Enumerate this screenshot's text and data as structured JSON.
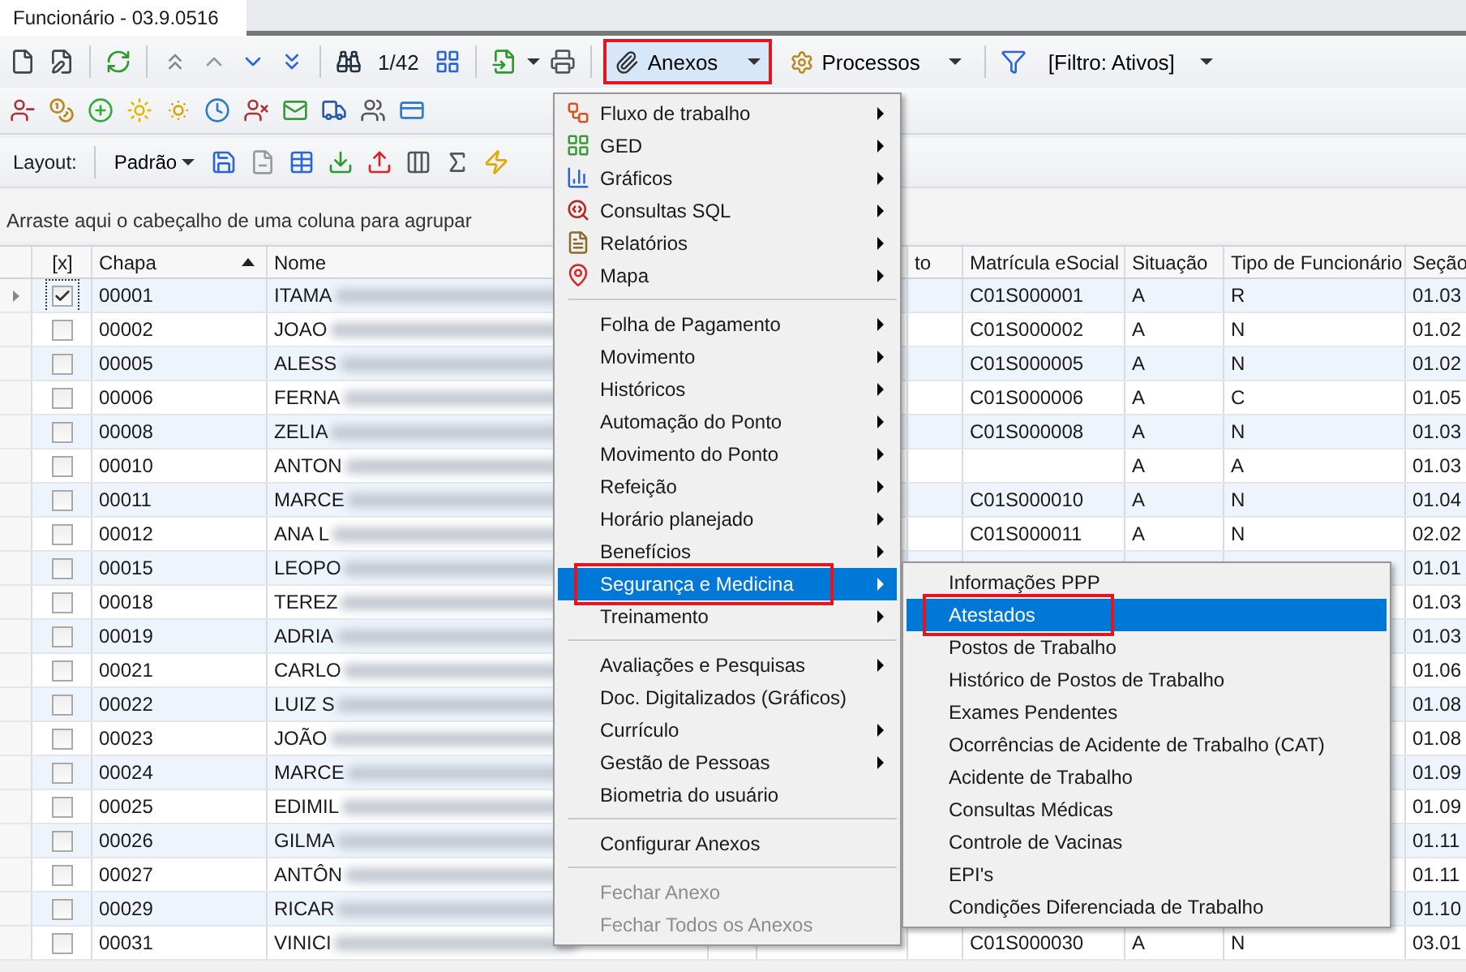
{
  "tab": {
    "title": "Funcionário - 03.9.0516"
  },
  "toolbar": {
    "counter": "1/42",
    "buttons": [
      {
        "label": "Anexos",
        "selected": true,
        "annotated": true
      },
      {
        "label": "Processos",
        "selected": false,
        "annotated": false
      }
    ],
    "filter": "[Filtro: Ativos]"
  },
  "layout_bar": {
    "label": "Layout:",
    "preset": "Padrão"
  },
  "group_panel": {
    "hint": "Arraste aqui o cabeçalho de uma coluna para agrupar"
  },
  "grid": {
    "columns": [
      {
        "label": "[x]",
        "sorted": false
      },
      {
        "label": "Chapa",
        "sorted": true
      },
      {
        "label": "Nome",
        "sorted": false
      },
      {
        "label": "to",
        "sorted": false
      },
      {
        "label": "Matrícula eSocial",
        "sorted": false
      },
      {
        "label": "Situação",
        "sorted": false
      },
      {
        "label": "Tipo de Funcionário",
        "sorted": false
      },
      {
        "label": "Seção",
        "sorted": false
      }
    ],
    "rows": [
      {
        "chapa": "00001",
        "nome": "ITAMA",
        "checked": true,
        "current": true,
        "matricula": "C01S000001",
        "situacao": "A",
        "tipo": "R",
        "secao": "01.03"
      },
      {
        "chapa": "00002",
        "nome": "JOAO",
        "checked": false,
        "current": false,
        "matricula": "C01S000002",
        "situacao": "A",
        "tipo": "N",
        "secao": "01.02"
      },
      {
        "chapa": "00005",
        "nome": "ALESS",
        "checked": false,
        "current": false,
        "matricula": "C01S000005",
        "situacao": "A",
        "tipo": "N",
        "secao": "01.02"
      },
      {
        "chapa": "00006",
        "nome": "FERNA",
        "checked": false,
        "current": false,
        "matricula": "C01S000006",
        "situacao": "A",
        "tipo": "C",
        "secao": "01.05"
      },
      {
        "chapa": "00008",
        "nome": "ZELIA",
        "checked": false,
        "current": false,
        "matricula": "C01S000008",
        "situacao": "A",
        "tipo": "N",
        "secao": "01.03"
      },
      {
        "chapa": "00010",
        "nome": "ANTON",
        "checked": false,
        "current": false,
        "situacao": "A",
        "tipo": "A",
        "secao": "01.03"
      },
      {
        "chapa": "00011",
        "nome": "MARCE",
        "checked": false,
        "current": false,
        "matricula": "C01S000010",
        "situacao": "A",
        "tipo": "N",
        "secao": "01.04"
      },
      {
        "chapa": "00012",
        "nome": "ANA L",
        "checked": false,
        "current": false,
        "matricula": "C01S000011",
        "situacao": "A",
        "tipo": "N",
        "secao": "02.02"
      },
      {
        "chapa": "00015",
        "nome": "LEOPO",
        "checked": false,
        "current": false,
        "secao": "01.01"
      },
      {
        "chapa": "00018",
        "nome": "TEREZ",
        "checked": false,
        "current": false,
        "secao": "01.03"
      },
      {
        "chapa": "00019",
        "nome": "ADRIA",
        "checked": false,
        "current": false,
        "secao": "01.03"
      },
      {
        "chapa": "00021",
        "nome": "CARLO",
        "checked": false,
        "current": false,
        "secao": "01.06"
      },
      {
        "chapa": "00022",
        "nome": "LUIZ S",
        "checked": false,
        "current": false,
        "secao": "01.08"
      },
      {
        "chapa": "00023",
        "nome": "JOÃO",
        "checked": false,
        "current": false,
        "secao": "01.08"
      },
      {
        "chapa": "00024",
        "nome": "MARCE",
        "checked": false,
        "current": false,
        "secao": "01.09"
      },
      {
        "chapa": "00025",
        "nome": "EDIMIL",
        "checked": false,
        "current": false,
        "secao": "01.09"
      },
      {
        "chapa": "00026",
        "nome": "GILMA",
        "checked": false,
        "current": false,
        "secao": "01.11"
      },
      {
        "chapa": "00027",
        "nome": "ANTÔN",
        "checked": false,
        "current": false,
        "secao": "01.11"
      },
      {
        "chapa": "00029",
        "nome": "RICAR",
        "checked": false,
        "current": false,
        "secao": "01.10"
      },
      {
        "chapa": "00031",
        "nome": "VINICI",
        "checked": false,
        "current": false,
        "matricula": "C01S000030",
        "situacao": "A",
        "tipo": "N",
        "secao": "03.01"
      }
    ]
  },
  "menu": {
    "groups": [
      [
        {
          "label": "Fluxo de trabalho",
          "submenu": true,
          "disabled": false,
          "selected": false,
          "annotated": false
        },
        {
          "label": "GED",
          "submenu": true,
          "disabled": false,
          "selected": false,
          "annotated": false
        },
        {
          "label": "Gráficos",
          "submenu": true,
          "disabled": false,
          "selected": false,
          "annotated": false
        },
        {
          "label": "Consultas SQL",
          "submenu": true,
          "disabled": false,
          "selected": false,
          "annotated": false
        },
        {
          "label": "Relatórios",
          "submenu": true,
          "disabled": false,
          "selected": false,
          "annotated": false
        },
        {
          "label": "Mapa",
          "submenu": true,
          "disabled": false,
          "selected": false,
          "annotated": false
        }
      ],
      [
        {
          "label": "Folha de Pagamento",
          "submenu": true,
          "disabled": false,
          "selected": false,
          "annotated": false
        },
        {
          "label": "Movimento",
          "submenu": true,
          "disabled": false,
          "selected": false,
          "annotated": false
        },
        {
          "label": "Históricos",
          "submenu": true,
          "disabled": false,
          "selected": false,
          "annotated": false
        },
        {
          "label": "Automação do Ponto",
          "submenu": true,
          "disabled": false,
          "selected": false,
          "annotated": false
        },
        {
          "label": "Movimento do Ponto",
          "submenu": true,
          "disabled": false,
          "selected": false,
          "annotated": false
        },
        {
          "label": "Refeição",
          "submenu": true,
          "disabled": false,
          "selected": false,
          "annotated": false
        },
        {
          "label": "Horário planejado",
          "submenu": true,
          "disabled": false,
          "selected": false,
          "annotated": false
        },
        {
          "label": "Benefícios",
          "submenu": true,
          "disabled": false,
          "selected": false,
          "annotated": false
        },
        {
          "label": "Segurança e Medicina",
          "submenu": true,
          "disabled": false,
          "selected": true,
          "annotated": true
        },
        {
          "label": "Treinamento",
          "submenu": true,
          "disabled": false,
          "selected": false,
          "annotated": false
        }
      ],
      [
        {
          "label": "Avaliações e Pesquisas",
          "submenu": true,
          "disabled": false,
          "selected": false,
          "annotated": false
        },
        {
          "label": "Doc. Digitalizados (Gráficos)",
          "submenu": false,
          "disabled": false,
          "selected": false,
          "annotated": false
        },
        {
          "label": "Currículo",
          "submenu": true,
          "disabled": false,
          "selected": false,
          "annotated": false
        },
        {
          "label": "Gestão de Pessoas",
          "submenu": true,
          "disabled": false,
          "selected": false,
          "annotated": false
        },
        {
          "label": "Biometria do usuário",
          "submenu": false,
          "disabled": false,
          "selected": false,
          "annotated": false
        }
      ],
      [
        {
          "label": "Configurar Anexos",
          "submenu": false,
          "disabled": false,
          "selected": false,
          "annotated": false
        }
      ],
      [
        {
          "label": "Fechar Anexo",
          "submenu": false,
          "disabled": true,
          "selected": false,
          "annotated": false
        },
        {
          "label": "Fechar Todos os Anexos",
          "submenu": false,
          "disabled": true,
          "selected": false,
          "annotated": false
        }
      ]
    ]
  },
  "submenu": {
    "items": [
      {
        "label": "Informações PPP",
        "selected": false,
        "annotated": false
      },
      {
        "label": "Atestados",
        "selected": true,
        "annotated": true
      },
      {
        "label": "Postos de Trabalho",
        "selected": false,
        "annotated": false
      },
      {
        "label": "Histórico de Postos de Trabalho",
        "selected": false,
        "annotated": false
      },
      {
        "label": "Exames Pendentes",
        "selected": false,
        "annotated": false
      },
      {
        "label": "Ocorrências de Acidente de Trabalho (CAT)",
        "selected": false,
        "annotated": false
      },
      {
        "label": "Acidente de Trabalho",
        "selected": false,
        "annotated": false
      },
      {
        "label": "Consultas Médicas",
        "selected": false,
        "annotated": false
      },
      {
        "label": "Controle de Vacinas",
        "selected": false,
        "annotated": false
      },
      {
        "label": "EPI's",
        "selected": false,
        "annotated": false
      },
      {
        "label": "Condições Diferenciada de Trabalho",
        "selected": false,
        "annotated": false
      }
    ]
  }
}
